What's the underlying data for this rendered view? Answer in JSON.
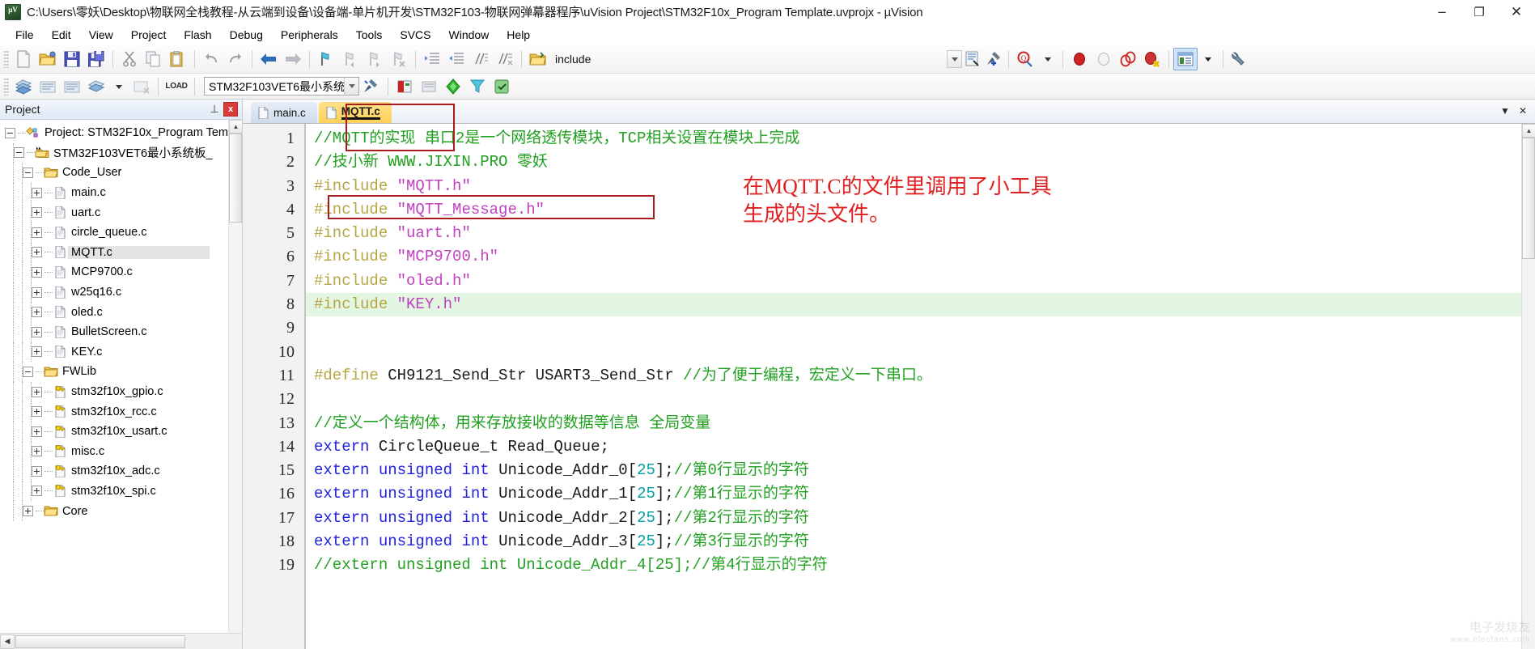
{
  "window": {
    "title": "C:\\Users\\零妖\\Desktop\\物联网全栈教程-从云端到设备\\设备端-单片机开发\\STM32F103-物联网弹幕器程序\\uVision Project\\STM32F10x_Program Template.uvprojx - µVision",
    "app_icon": "uvision-icon",
    "minimize": "−",
    "maximize": "❐",
    "close": "✕"
  },
  "menubar": {
    "items": [
      "File",
      "Edit",
      "View",
      "Project",
      "Flash",
      "Debug",
      "Peripherals",
      "Tools",
      "SVCS",
      "Window",
      "Help"
    ]
  },
  "toolbar": {
    "include_label": "include",
    "target": "STM32F103VET6最小系统",
    "load_label": "LOAD"
  },
  "project_panel": {
    "title": "Project",
    "pin": "⊥",
    "close": "x",
    "tree": [
      {
        "label": "Project: STM32F10x_Program Tem",
        "depth": 0,
        "icon": "project-icon",
        "expander": "minus"
      },
      {
        "label": "STM32F103VET6最小系统板_",
        "depth": 1,
        "icon": "target-icon",
        "expander": "minus"
      },
      {
        "label": "Code_User",
        "depth": 2,
        "icon": "folder-icon",
        "expander": "minus"
      },
      {
        "label": "main.c",
        "depth": 3,
        "icon": "file-icon",
        "expander": "plus"
      },
      {
        "label": "uart.c",
        "depth": 3,
        "icon": "file-icon",
        "expander": "plus"
      },
      {
        "label": "circle_queue.c",
        "depth": 3,
        "icon": "file-icon",
        "expander": "plus"
      },
      {
        "label": "MQTT.c",
        "depth": 3,
        "icon": "file-icon",
        "expander": "plus",
        "selected": true
      },
      {
        "label": "MCP9700.c",
        "depth": 3,
        "icon": "file-icon",
        "expander": "plus"
      },
      {
        "label": "w25q16.c",
        "depth": 3,
        "icon": "file-icon",
        "expander": "plus"
      },
      {
        "label": "oled.c",
        "depth": 3,
        "icon": "file-icon",
        "expander": "plus"
      },
      {
        "label": "BulletScreen.c",
        "depth": 3,
        "icon": "file-icon",
        "expander": "plus"
      },
      {
        "label": "KEY.c",
        "depth": 3,
        "icon": "file-icon",
        "expander": "plus"
      },
      {
        "label": "FWLib",
        "depth": 2,
        "icon": "folder-icon",
        "expander": "minus"
      },
      {
        "label": "stm32f10x_gpio.c",
        "depth": 3,
        "icon": "file-key-icon",
        "expander": "plus"
      },
      {
        "label": "stm32f10x_rcc.c",
        "depth": 3,
        "icon": "file-key-icon",
        "expander": "plus"
      },
      {
        "label": "stm32f10x_usart.c",
        "depth": 3,
        "icon": "file-key-icon",
        "expander": "plus"
      },
      {
        "label": "misc.c",
        "depth": 3,
        "icon": "file-key-icon",
        "expander": "plus"
      },
      {
        "label": "stm32f10x_adc.c",
        "depth": 3,
        "icon": "file-key-icon",
        "expander": "plus"
      },
      {
        "label": "stm32f10x_spi.c",
        "depth": 3,
        "icon": "file-key-icon",
        "expander": "plus"
      },
      {
        "label": "Core",
        "depth": 2,
        "icon": "folder-icon",
        "expander": "plus"
      }
    ]
  },
  "editor": {
    "tabs": [
      {
        "label": "main.c",
        "active": false
      },
      {
        "label": "MQTT.c",
        "active": true
      }
    ],
    "first_line": 1,
    "lines": [
      {
        "n": 1,
        "segs": [
          {
            "t": "//MQTT的实现 串口2是一个网络透传模块，TCP相关设置在模块上完成",
            "c": "c-comment"
          }
        ]
      },
      {
        "n": 2,
        "segs": [
          {
            "t": "//技小新 WWW.JIXIN.PRO 零妖",
            "c": "c-comment"
          }
        ]
      },
      {
        "n": 3,
        "segs": [
          {
            "t": "#include ",
            "c": "c-pre"
          },
          {
            "t": "\"MQTT.h\"",
            "c": "c-str"
          }
        ]
      },
      {
        "n": 4,
        "segs": [
          {
            "t": "#include ",
            "c": "c-pre"
          },
          {
            "t": "\"MQTT_Message.h\"",
            "c": "c-str"
          }
        ]
      },
      {
        "n": 5,
        "segs": [
          {
            "t": "#include ",
            "c": "c-pre"
          },
          {
            "t": "\"uart.h\"",
            "c": "c-str"
          }
        ]
      },
      {
        "n": 6,
        "segs": [
          {
            "t": "#include ",
            "c": "c-pre"
          },
          {
            "t": "\"MCP9700.h\"",
            "c": "c-str"
          }
        ]
      },
      {
        "n": 7,
        "segs": [
          {
            "t": "#include ",
            "c": "c-pre"
          },
          {
            "t": "\"oled.h\"",
            "c": "c-str"
          }
        ]
      },
      {
        "n": 8,
        "highlight": true,
        "segs": [
          {
            "t": "#include ",
            "c": "c-pre"
          },
          {
            "t": "\"KEY.h\"",
            "c": "c-str"
          }
        ]
      },
      {
        "n": 9,
        "segs": []
      },
      {
        "n": 10,
        "segs": []
      },
      {
        "n": 11,
        "segs": [
          {
            "t": "#define ",
            "c": "c-pre"
          },
          {
            "t": "CH9121_Send_Str USART3_Send_Str ",
            "c": "c-plain"
          },
          {
            "t": "//为了便于编程，宏定义一下串口。",
            "c": "c-comment"
          }
        ]
      },
      {
        "n": 12,
        "segs": []
      },
      {
        "n": 13,
        "segs": [
          {
            "t": "//定义一个结构体，用来存放接收的数据等信息 全局变量",
            "c": "c-comment"
          }
        ]
      },
      {
        "n": 14,
        "segs": [
          {
            "t": "extern ",
            "c": "c-kw"
          },
          {
            "t": "CircleQueue_t Read_Queue;",
            "c": "c-plain"
          }
        ]
      },
      {
        "n": 15,
        "segs": [
          {
            "t": "extern ",
            "c": "c-kw"
          },
          {
            "t": "unsigned ",
            "c": "c-kw"
          },
          {
            "t": "int ",
            "c": "c-kw"
          },
          {
            "t": "Unicode_Addr_0[",
            "c": "c-plain"
          },
          {
            "t": "25",
            "c": "c-num"
          },
          {
            "t": "];",
            "c": "c-plain"
          },
          {
            "t": "//第0行显示的字符",
            "c": "c-comment"
          }
        ]
      },
      {
        "n": 16,
        "segs": [
          {
            "t": "extern ",
            "c": "c-kw"
          },
          {
            "t": "unsigned ",
            "c": "c-kw"
          },
          {
            "t": "int ",
            "c": "c-kw"
          },
          {
            "t": "Unicode_Addr_1[",
            "c": "c-plain"
          },
          {
            "t": "25",
            "c": "c-num"
          },
          {
            "t": "];",
            "c": "c-plain"
          },
          {
            "t": "//第1行显示的字符",
            "c": "c-comment"
          }
        ]
      },
      {
        "n": 17,
        "segs": [
          {
            "t": "extern ",
            "c": "c-kw"
          },
          {
            "t": "unsigned ",
            "c": "c-kw"
          },
          {
            "t": "int ",
            "c": "c-kw"
          },
          {
            "t": "Unicode_Addr_2[",
            "c": "c-plain"
          },
          {
            "t": "25",
            "c": "c-num"
          },
          {
            "t": "];",
            "c": "c-plain"
          },
          {
            "t": "//第2行显示的字符",
            "c": "c-comment"
          }
        ]
      },
      {
        "n": 18,
        "segs": [
          {
            "t": "extern ",
            "c": "c-kw"
          },
          {
            "t": "unsigned ",
            "c": "c-kw"
          },
          {
            "t": "int ",
            "c": "c-kw"
          },
          {
            "t": "Unicode_Addr_3[",
            "c": "c-plain"
          },
          {
            "t": "25",
            "c": "c-num"
          },
          {
            "t": "];",
            "c": "c-plain"
          },
          {
            "t": "//第3行显示的字符",
            "c": "c-comment"
          }
        ]
      },
      {
        "n": 19,
        "segs": [
          {
            "t": "//extern unsigned int Unicode_Addr_4[25];//第4行显示的字符",
            "c": "c-comment"
          }
        ]
      }
    ]
  },
  "annotation": {
    "text_line1": "在MQTT.C的文件里调用了小工具",
    "text_line2": "生成的头文件。",
    "color": "#e02020"
  },
  "watermark": {
    "text": "电子发烧友",
    "sub": "www.elecfans.com"
  },
  "colors": {
    "comment": "#22a022",
    "preproc": "#b5a642",
    "string": "#c040c0",
    "keyword": "#2222dd",
    "number": "#00a0a0",
    "annotation": "#a81c1c",
    "active_tab": "#ffd158"
  }
}
